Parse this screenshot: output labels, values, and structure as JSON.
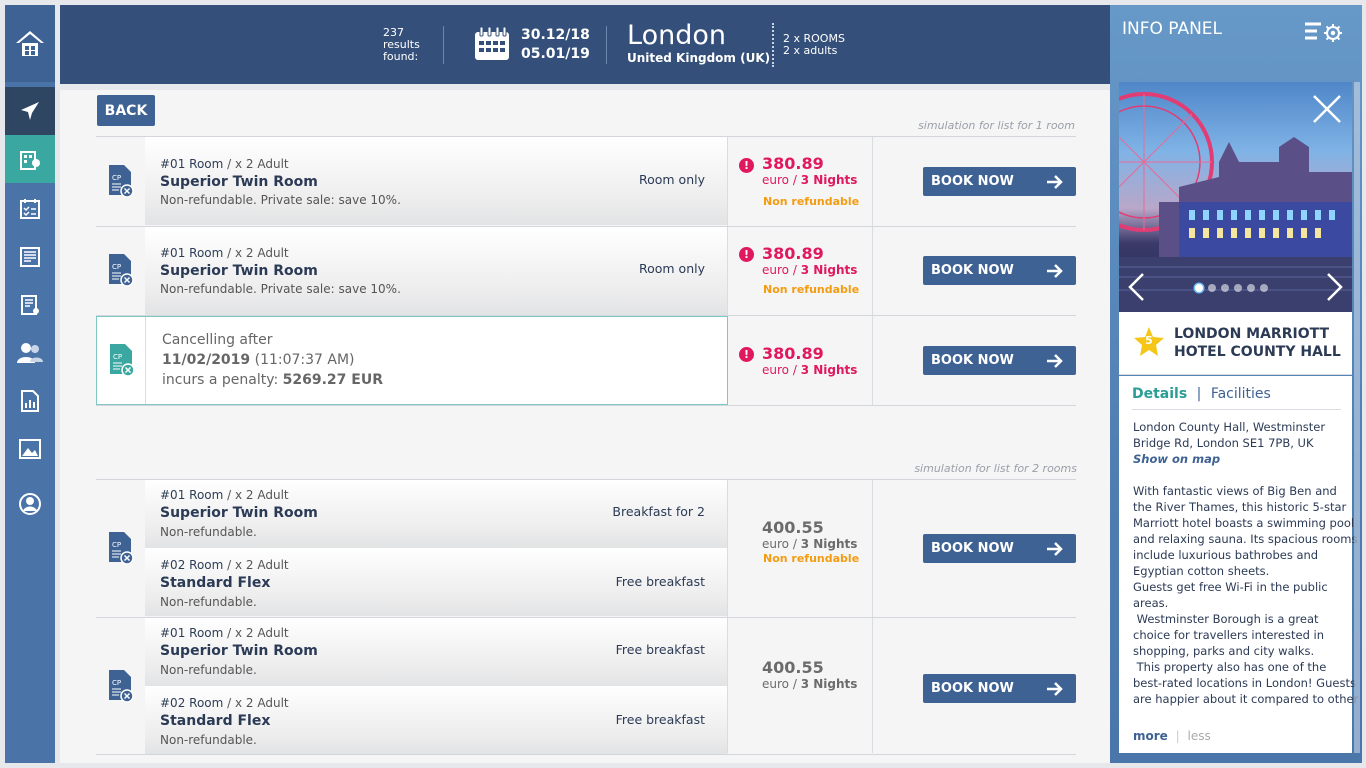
{
  "header": {
    "results_count": "237",
    "results_label1": "results",
    "results_label2": "found:",
    "date_from": "30.12/18",
    "date_to": "05.01/19",
    "city": "London",
    "country": "United Kingdom (UK)",
    "rooms": "2 x ROOMS",
    "adults": "2 x adults"
  },
  "back_label": "BACK",
  "simulation_1_label": "simulation for list for 1 room",
  "simulation_2_label": "simulation for list for 2 rooms",
  "book_label": "BOOK NOW",
  "single_rooms": [
    {
      "num": "#01 Room",
      "guests": "x 2 Adult",
      "name": "Superior Twin Room",
      "note": "Non-refundable. Private sale: save 10%.",
      "board": "Room only",
      "price": "380.89",
      "nights_prefix": "euro /",
      "nights": "3 Nights",
      "refund": "Non refundable"
    },
    {
      "num": "#01 Room",
      "guests": "x 2 Adult",
      "name": "Superior Twin Room",
      "note": "Non-refundable. Private sale: save 10%.",
      "board": "Room only",
      "price": "380.89",
      "nights_prefix": "euro /",
      "nights": "3 Nights",
      "refund": "Non refundable"
    }
  ],
  "cancel_row": {
    "line1": "Cancelling after",
    "date": "11/02/2019",
    "time": "(11:07:37 AM)",
    "penalty_prefix": "incurs a penalty:",
    "penalty": "5269.27 EUR",
    "price": "380.89",
    "nights_prefix": "euro /",
    "nights": "3 Nights"
  },
  "double_rooms": [
    {
      "rooms": [
        {
          "num": "#01 Room",
          "guests": "x 2 Adult",
          "name": "Superior Twin Room",
          "note": "Non-refundable.",
          "board": "Breakfast for 2"
        },
        {
          "num": "#02 Room",
          "guests": "x 2 Adult",
          "name": "Standard Flex",
          "note": "Non-refundable.",
          "board": "Free breakfast"
        }
      ],
      "price": "400.55",
      "nights_prefix": "euro /",
      "nights": "3 Nights",
      "refund": "Non refundable"
    },
    {
      "rooms": [
        {
          "num": "#01 Room",
          "guests": "x 2 Adult",
          "name": "Superior Twin Room",
          "note": "Non-refundable.",
          "board": "Free breakfast"
        },
        {
          "num": "#02 Room",
          "guests": "x 2 Adult",
          "name": "Standard Flex",
          "note": "Non-refundable.",
          "board": "Free breakfast"
        }
      ],
      "price": "400.55",
      "nights_prefix": "euro /",
      "nights": "3 Nights"
    }
  ],
  "info_panel": {
    "title": "INFO PANEL",
    "hotel_stars": "5",
    "hotel_name_1": "LONDON MARRIOTT",
    "hotel_name_2": "HOTEL COUNTY HALL",
    "tab_details": "Details",
    "tab_sep": "|",
    "tab_facilities": "Facilities",
    "address_1": "London County Hall, Westminster",
    "address_2": "Bridge Rd, London SE1 7PB, UK",
    "show_map": "Show on map",
    "description": [
      "With fantastic views of Big Ben and",
      "the River Thames, this historic 5-star",
      "Marriott hotel boasts a swimming pool",
      "and relaxing sauna. Its spacious rooms",
      "include luxurious bathrobes and",
      "Egyptian cotton sheets.",
      "Guests get free Wi-Fi in the public",
      "areas.",
      " Westminster Borough is a great",
      "choice for travellers interested in",
      "shopping, parks and city walks.",
      " This property also has one of the",
      "best-rated locations in London! Guests",
      "are happier about it compared to other"
    ],
    "more": "more",
    "more_sep": "|",
    "less": "less",
    "slide_count": 6,
    "slide_active": 1
  },
  "colors": {
    "price_pink": "#e0185e",
    "price_grey": "#6b6b6b",
    "refund_orange": "#f39c12",
    "nav_dark": "#34507a",
    "accent_teal": "#3aa7a0"
  }
}
